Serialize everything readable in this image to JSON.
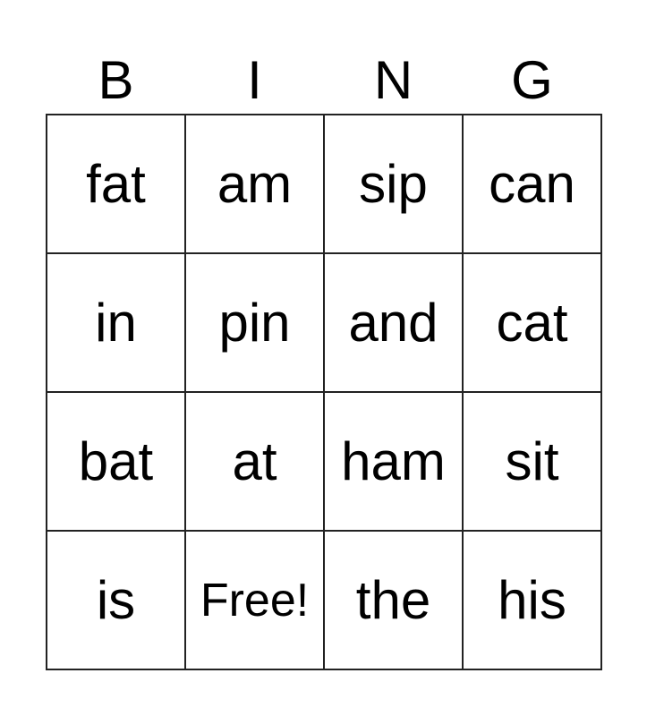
{
  "card": {
    "header": [
      "B",
      "I",
      "N",
      "G"
    ],
    "rows": [
      [
        "fat",
        "am",
        "sip",
        "can"
      ],
      [
        "in",
        "pin",
        "and",
        "cat"
      ],
      [
        "bat",
        "at",
        "ham",
        "sit"
      ],
      [
        "is",
        "Free!",
        "the",
        "his"
      ]
    ],
    "free_label": "Free!"
  }
}
